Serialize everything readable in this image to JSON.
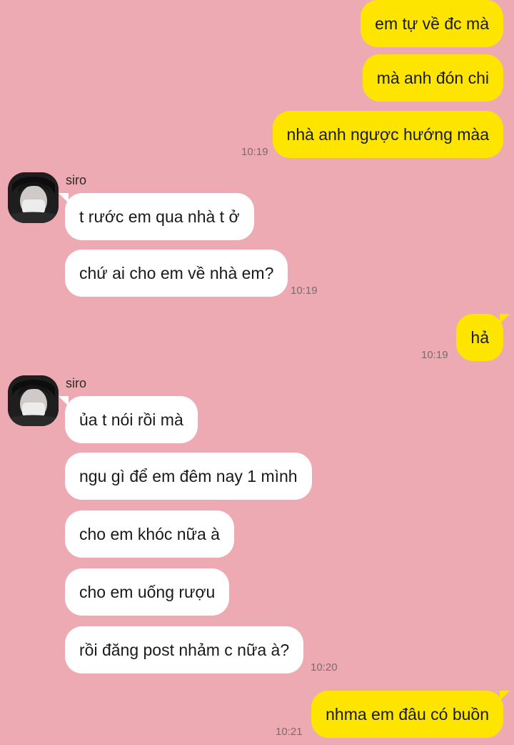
{
  "messages": [
    {
      "text": "em tự về đc mà"
    },
    {
      "text": "mà anh đón chi"
    },
    {
      "text": "nhà anh ngược hướng màa",
      "time": "10:19"
    },
    {
      "sender": "siro",
      "text": "t rước em qua nhà t ở"
    },
    {
      "text": "chứ ai cho em về nhà em?",
      "time": "10:19"
    },
    {
      "text": "hả",
      "time": "10:19"
    },
    {
      "sender": "siro",
      "text": "ủa t nói rồi mà"
    },
    {
      "text": "ngu gì để em đêm nay 1 mình"
    },
    {
      "text": "cho em khóc nữa à"
    },
    {
      "text": "cho em uống rượu"
    },
    {
      "text": "rồi đăng post nhảm c nữa à?",
      "time": "10:20"
    },
    {
      "text": "nhma em đâu có buồn",
      "time": "10:21"
    }
  ],
  "colors": {
    "background": "#EEAAB2",
    "outgoing_bubble": "#FEE500",
    "incoming_bubble": "#FFFFFF"
  },
  "icons": [
    "avatar-photo-icon"
  ]
}
